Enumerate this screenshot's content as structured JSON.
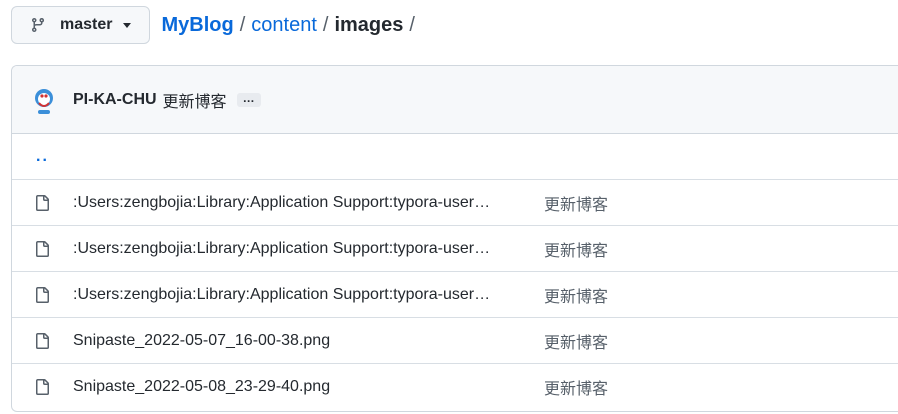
{
  "branch": {
    "label": "master",
    "icon": "git-branch-icon"
  },
  "breadcrumb": {
    "repo": "MyBlog",
    "sep1": "/",
    "dir": "content",
    "sep2": "/",
    "current": "images",
    "sep3": "/"
  },
  "commit": {
    "author": "PI-KA-CHU",
    "message": "更新博客",
    "ellipsis": "…"
  },
  "parent_dir": {
    "label": ".."
  },
  "files": [
    {
      "name": ":Users:zengbojia:Library:Application Support:typora-user…",
      "message": "更新博客",
      "icon": "file-icon"
    },
    {
      "name": ":Users:zengbojia:Library:Application Support:typora-user…",
      "message": "更新博客",
      "icon": "file-icon"
    },
    {
      "name": ":Users:zengbojia:Library:Application Support:typora-user…",
      "message": "更新博客",
      "icon": "file-icon"
    },
    {
      "name": "Snipaste_2022-05-07_16-00-38.png",
      "message": "更新博客",
      "icon": "file-icon"
    },
    {
      "name": "Snipaste_2022-05-08_23-29-40.png",
      "message": "更新博客",
      "icon": "file-icon"
    }
  ]
}
